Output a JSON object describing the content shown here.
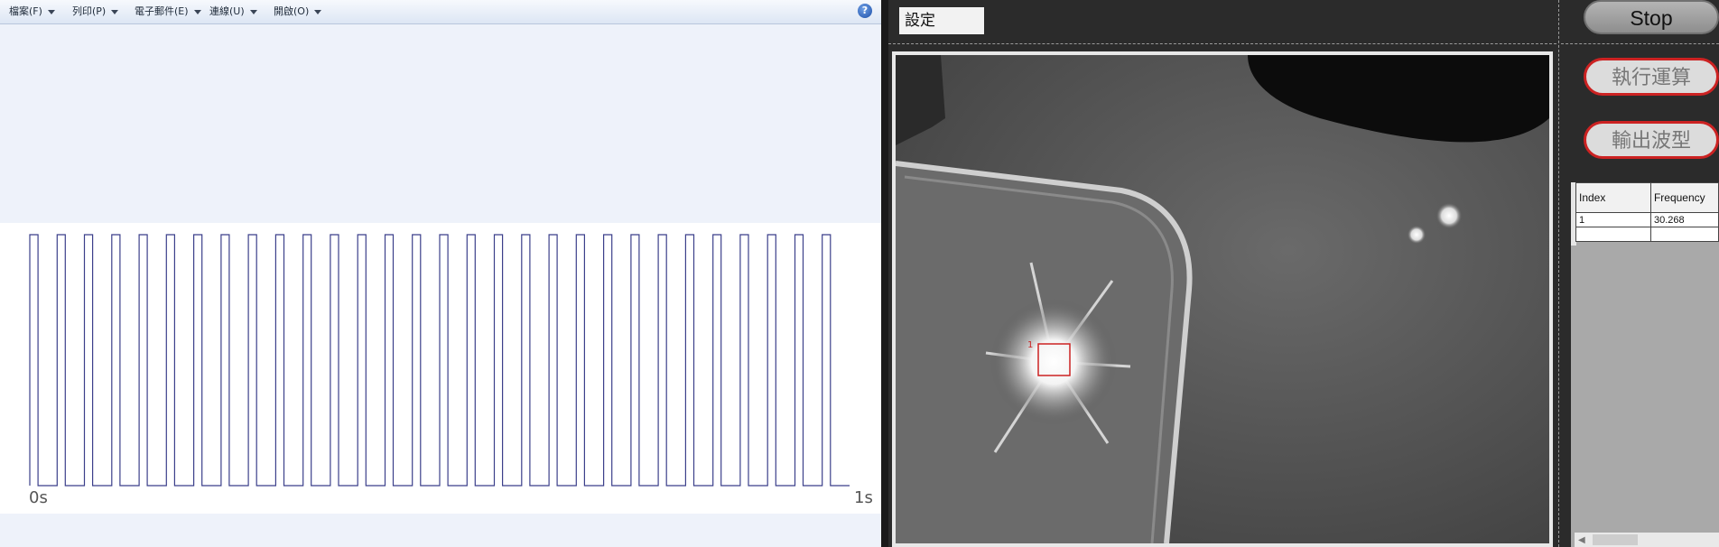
{
  "menu": {
    "items": [
      {
        "label": "檔案(F)"
      },
      {
        "label": "列印(P)"
      },
      {
        "label": "電子郵件(E)"
      },
      {
        "label": "連線(U)"
      },
      {
        "label": "開啟(O)"
      }
    ],
    "help_icon": "question-circle-icon",
    "help_glyph": "?"
  },
  "waveform": {
    "x_start_label": "0s",
    "x_end_label": "1s",
    "cycles": 30,
    "duty_high": 0.3,
    "line_color": "#3b3f8a"
  },
  "right_panel": {
    "settings_label": "設定",
    "stop_label": "Stop",
    "calc_label": "執行運算",
    "output_label": "輸出波型",
    "accent_color": "#cc2222",
    "roi_color": "#cc2222",
    "roi_tag": "1"
  },
  "results_table": {
    "headers": [
      "Index",
      "Frequency"
    ],
    "rows": [
      [
        "1",
        "30.268"
      ],
      [
        "",
        ""
      ]
    ]
  }
}
